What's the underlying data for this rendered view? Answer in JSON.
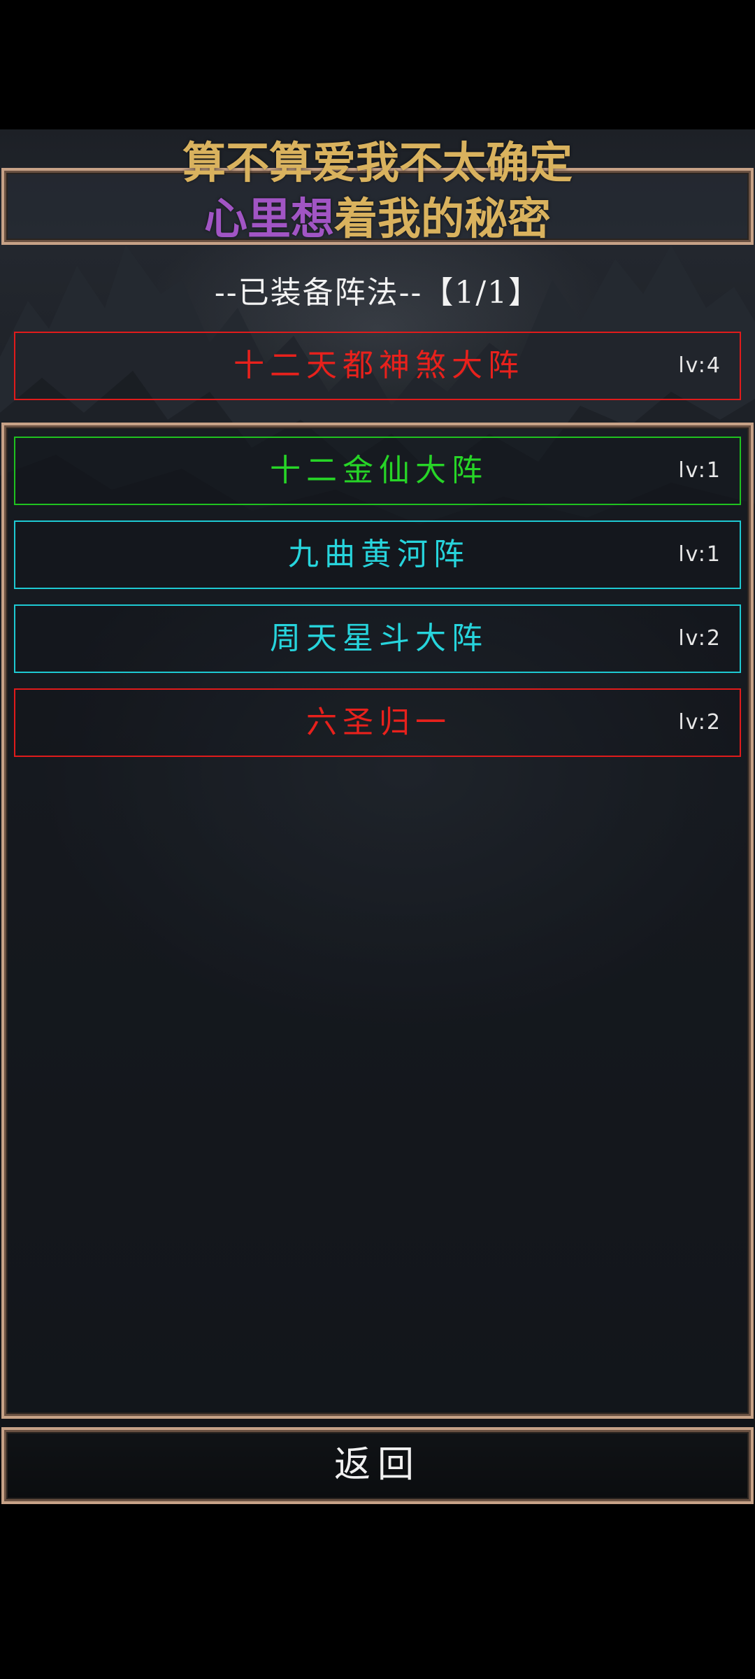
{
  "overlay_lyrics": {
    "line1": "算不算爱我不太确定",
    "line2_purple": "心里想",
    "line2_rest": "着我的秘密"
  },
  "equipped": {
    "title": "--已装备阵法--【1/1】",
    "items": [
      {
        "name": "十二天都神煞大阵",
        "level": "lv:4",
        "color": "#e8211c"
      }
    ]
  },
  "formations": [
    {
      "name": "十二金仙大阵",
      "level": "lv:1",
      "color": "#27d527"
    },
    {
      "name": "九曲黄河阵",
      "level": "lv:1",
      "color": "#27d4dc"
    },
    {
      "name": "周天星斗大阵",
      "level": "lv:2",
      "color": "#27d4dc"
    },
    {
      "name": "六圣归一",
      "level": "lv:2",
      "color": "#e8211c"
    }
  ],
  "footer": {
    "back_label": "返回"
  },
  "colors": {
    "frame_border": "#c7a287",
    "background": "#1c2026"
  }
}
